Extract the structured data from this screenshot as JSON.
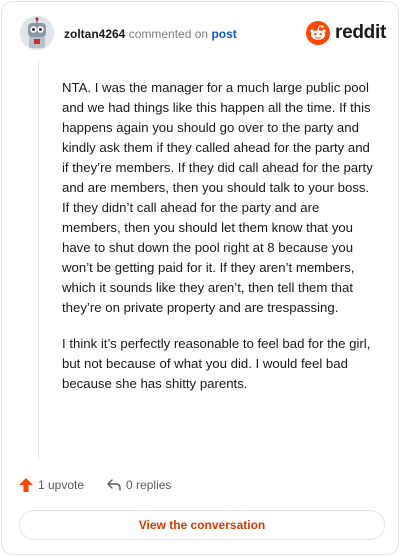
{
  "comment": {
    "username": "zoltan4264",
    "action_text": "commented on",
    "post_link": "post",
    "paragraphs": [
      "NTA. I was the manager for a much large public pool and we had things like this happen all the time. If this happens again you should go over to the party and kindly ask them if they called ahead for the party and if they’re members. If they did call ahead for the party and are members, then you should talk to your boss. If they didn’t call ahead for the party and are members, then you should let them know that you have to shut down the pool right at 8 because you won’t be getting paid for it. If they aren’t members, which it sounds like they aren’t, then tell them that they’re on private property and are trespassing.",
      "I think it’s perfectly reasonable to feel bad for the girl, but not because of what you did. I would feel bad because she has shitty parents."
    ]
  },
  "brand": {
    "name": "reddit",
    "icon": "reddit-logo-icon",
    "color": "#ff4500"
  },
  "actions": {
    "upvote_label": "1 upvote",
    "replies_label": "0 replies"
  },
  "cta": {
    "label": "View the conversation",
    "color": "#d93a00"
  }
}
